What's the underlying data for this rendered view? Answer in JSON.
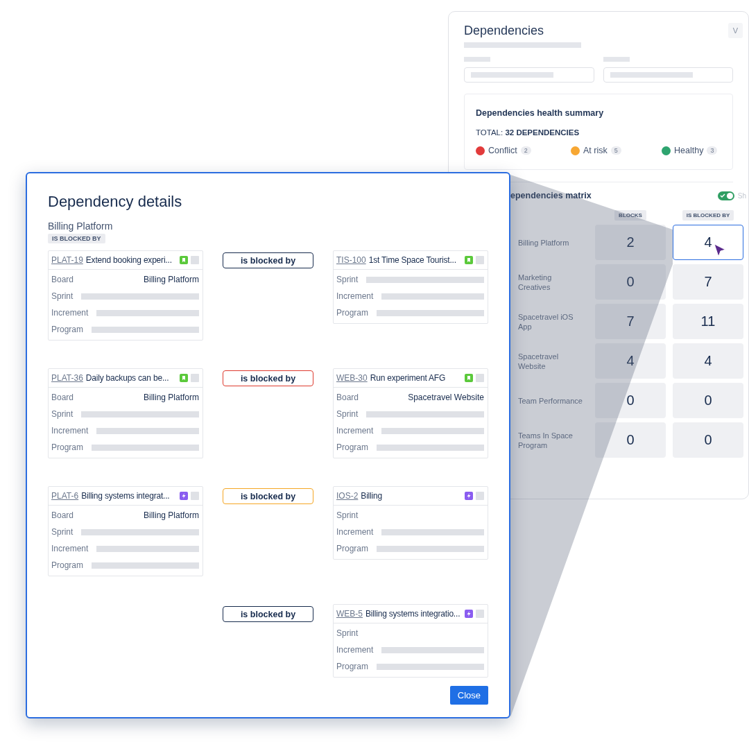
{
  "dependencies_page": {
    "title": "Dependencies",
    "view_button": "V",
    "health_summary": {
      "title": "Dependencies health summary",
      "total": "TOTAL: **32 DEPENDENCIES**",
      "statuses": [
        {
          "label": "Conflict",
          "count": "2",
          "color": "#e23b3b"
        },
        {
          "label": "At risk",
          "count": "5",
          "color": "#f7a733"
        },
        {
          "label": "Healthy",
          "count": "3",
          "color": "#2ea46f"
        }
      ]
    },
    "matrix": {
      "title": "ependencies matrix",
      "toggle": {
        "on": true,
        "label": "Sh"
      },
      "columns": [
        "BLOCKS",
        "IS BLOCKED BY"
      ],
      "rows": [
        {
          "name": "Billing Platform",
          "cells": [
            {
              "value": "2",
              "selected": false
            },
            {
              "value": "4",
              "selected": true
            }
          ]
        },
        {
          "name": "Marketing Creatives",
          "cells": [
            {
              "value": "0",
              "selected": false
            },
            {
              "value": "7",
              "selected": false
            }
          ]
        },
        {
          "name": "Spacetravel iOS App",
          "cells": [
            {
              "value": "7",
              "selected": false
            },
            {
              "value": "11",
              "selected": false
            }
          ]
        },
        {
          "name": "Spacetravel Website",
          "cells": [
            {
              "value": "4",
              "selected": false
            },
            {
              "value": "4",
              "selected": false
            }
          ]
        },
        {
          "name": "Team Performance",
          "cells": [
            {
              "value": "0",
              "selected": false
            },
            {
              "value": "0",
              "selected": false
            }
          ]
        },
        {
          "name": "Teams In Space Program",
          "cells": [
            {
              "value": "0",
              "selected": false
            },
            {
              "value": "0",
              "selected": false
            }
          ]
        }
      ]
    }
  },
  "dependency_details": {
    "title": "Dependency details",
    "board": "Billing Platform",
    "relation_badge": "IS BLOCKED BY",
    "pairs": [
      {
        "source": {
          "key": "PLAT-19",
          "summary": "Extend booking experi...",
          "kind": "story",
          "fields": [
            {
              "label": "Board",
              "kind": "text",
              "value": "Billing Platform"
            },
            {
              "label": "Sprint",
              "kind": "bar"
            },
            {
              "label": "Increment",
              "kind": "bar"
            },
            {
              "label": "Program",
              "kind": "bar"
            }
          ]
        },
        "relation": {
          "label": "is blocked by",
          "color": "#172b4d"
        },
        "target": {
          "key": "TIS-100",
          "summary": "1st Time Space Tourist...",
          "kind": "story",
          "fields": [
            {
              "label": "Sprint",
              "kind": "bar"
            },
            {
              "label": "Increment",
              "kind": "bar"
            },
            {
              "label": "Program",
              "kind": "bar"
            }
          ]
        }
      },
      {
        "source": {
          "key": "PLAT-36",
          "summary": "Daily backups can be...",
          "kind": "story",
          "fields": [
            {
              "label": "Board",
              "kind": "text",
              "value": "Billing Platform"
            },
            {
              "label": "Sprint",
              "kind": "bar"
            },
            {
              "label": "Increment",
              "kind": "bar"
            },
            {
              "label": "Program",
              "kind": "bar"
            }
          ]
        },
        "relation": {
          "label": "is blocked by",
          "color": "#de3b2f"
        },
        "target": {
          "key": "WEB-30",
          "summary": "Run experiment AFG",
          "kind": "story",
          "fields": [
            {
              "label": "Board",
              "kind": "text",
              "value": "Spacetravel Website"
            },
            {
              "label": "Sprint",
              "kind": "bar"
            },
            {
              "label": "Increment",
              "kind": "bar"
            },
            {
              "label": "Program",
              "kind": "bar"
            }
          ]
        }
      },
      {
        "source": {
          "key": "PLAT-6",
          "summary": "Billing systems integrat...",
          "kind": "epic",
          "fields": [
            {
              "label": "Board",
              "kind": "text",
              "value": "Billing Platform"
            },
            {
              "label": "Sprint",
              "kind": "bar"
            },
            {
              "label": "Increment",
              "kind": "bar"
            },
            {
              "label": "Program",
              "kind": "bar"
            }
          ]
        },
        "relation": {
          "label": "is blocked by",
          "color": "#f5a623"
        },
        "target": {
          "key": "IOS-2",
          "summary": "Billing",
          "kind": "epic",
          "fields": [
            {
              "label": "Sprint",
              "kind": "blank"
            },
            {
              "label": "Increment",
              "kind": "bar"
            },
            {
              "label": "Program",
              "kind": "bar"
            }
          ]
        }
      },
      {
        "relation": {
          "label": "is blocked by",
          "color": "#172b4d"
        },
        "target": {
          "key": "WEB-5",
          "summary": "Billing systems integratio...",
          "kind": "epic",
          "fields": [
            {
              "label": "Sprint",
              "kind": "blank"
            },
            {
              "label": "Increment",
              "kind": "bar"
            },
            {
              "label": "Program",
              "kind": "bar"
            }
          ]
        }
      }
    ],
    "close_button": "Close"
  }
}
